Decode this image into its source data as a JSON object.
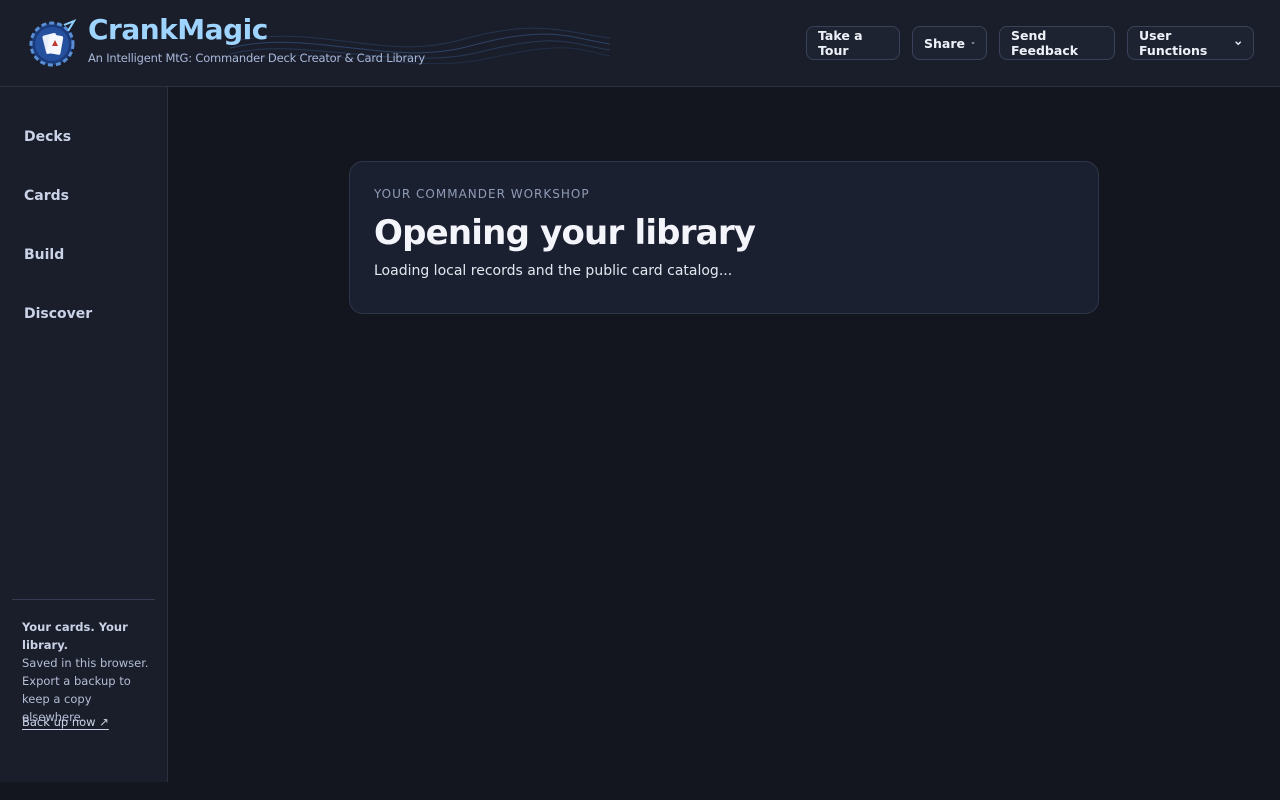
{
  "header": {
    "brand_title": "CrankMagic",
    "brand_subtitle": "An Intelligent MtG: Commander Deck Creator & Card Library",
    "buttons": {
      "tour": "Take a Tour",
      "share": "Share",
      "feedback": "Send Feedback",
      "user_functions": "User Functions"
    }
  },
  "sidebar": {
    "items": [
      {
        "label": "Decks"
      },
      {
        "label": "Cards"
      },
      {
        "label": "Build"
      },
      {
        "label": "Discover"
      }
    ],
    "note_title": "Your cards. Your library.",
    "note_body": "Saved in this browser. Export a backup to keep a copy elsewhere.",
    "backup_link": "Back up now ↗"
  },
  "main": {
    "eyebrow": "YOUR COMMANDER WORKSHOP",
    "title": "Opening your library",
    "subtitle": "Loading local records and the public card catalog..."
  },
  "colors": {
    "brand": "#9fd4ff",
    "background": "#13161f",
    "panel": "#1a1e2b",
    "card": "#1b2030"
  },
  "icons": {
    "logo": "crank-magic-logo",
    "dropdown": "chevron-down-icon"
  }
}
